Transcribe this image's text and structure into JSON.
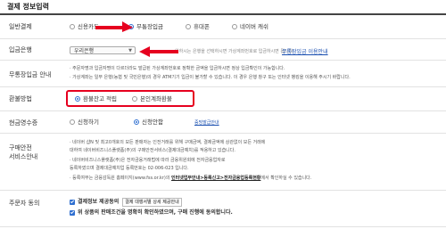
{
  "section_title": "결제 정보입력",
  "payment": {
    "label": "일반결제",
    "options": [
      "신용카드",
      "무통장입금",
      "휴대폰",
      "네이버 캐쉬"
    ],
    "selected": 1
  },
  "bank": {
    "label": "입금은행",
    "select_value": "우리은행",
    "note": "원하시는 은행을 선택하시면 가상계좌번호로 입금하시면 됩니다.",
    "guide_link": "무통장입금 이용안내"
  },
  "guide": {
    "label": "무통장입금 안내",
    "lines": [
      "· 주문자명과 입금자명이 다르더라도 발급된 가상계좌번호로 정확한 금액을 입금하시면 정상 입금확인이 가능합니다.",
      "· 가상계좌는 일부 은행(농협 및 국민은행)의 경우 ATM기기 입금이 불가할 수 있습니다. 이 경우 은행 창구 또는 인터넷 뱅킹을 이용해 주시기 바랍니다."
    ]
  },
  "refund": {
    "label": "환불방법",
    "options": [
      "환불잔고 적립",
      "본인계좌환불"
    ],
    "selected": 0
  },
  "receipt": {
    "label": "현금영수증",
    "options": [
      "신청하기",
      "신청안함"
    ],
    "selected": 1,
    "guide_link": "증빙발급안내"
  },
  "safety": {
    "label_1": "구매안전",
    "label_2": "서비스안내",
    "lines": [
      "· 네이버 샵N 및 최고0개호의 모든 판매자는 인전거래를 위해 구매금액, 결제금액에 상관없이 모든 거래에",
      "  대하여 네이버비즈니스플랫폼(주)의 구매안전서비스(결제대금예치)를 적용하고 있습니다.",
      "· 네이버비즈니스플랫폼(주)은 전자금융거래법에 따라 금융위원회에 전자금융업자로",
      "  등록하였으며 결제대금예치업 등록번호는 02-006-023 입니다.",
      "· 등록여부는 금융감독원 홈페이지(www.fss.or.kr)의 "
    ],
    "link": "인터넷업무안내>등록신고>전자금융업등록현황",
    "link_suffix": "에서 확인하실 수 있습니다."
  },
  "agree": {
    "label": "주문자 동의",
    "item1": "결제정보 제공동의",
    "item1_btn": "결제 대행서별 상세 제공안내",
    "item2": "위 상품의 판매조건을 명확히 확인하였으며, 구매 진행에 동의합니다."
  }
}
